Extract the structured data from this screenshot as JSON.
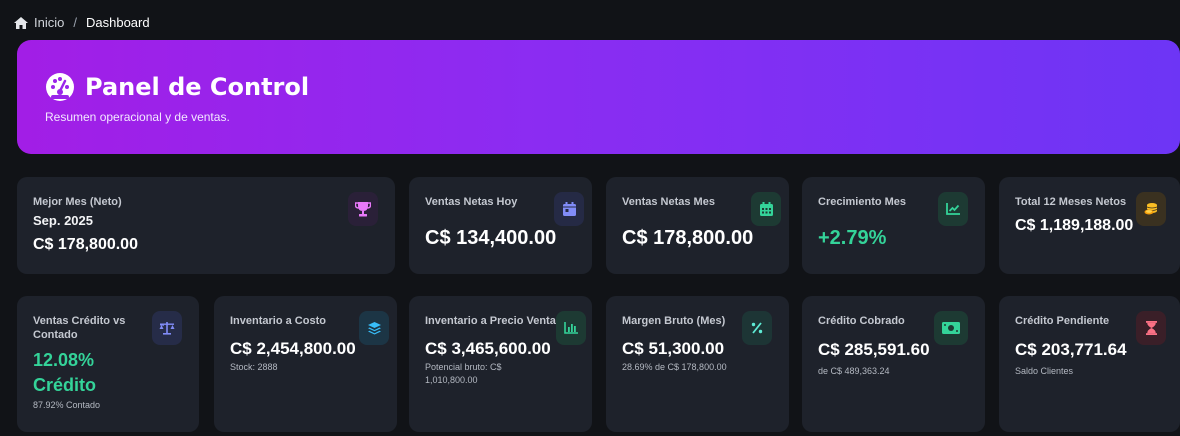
{
  "breadcrumb": {
    "home": "Inicio",
    "separator": "/",
    "current": "Dashboard"
  },
  "hero": {
    "title": "Panel de Control",
    "subtitle": "Resumen operacional y de ventas."
  },
  "colors": {
    "hero_start": "#a21ee6",
    "hero_end": "#6d35f5",
    "card_bg": "#1e222b",
    "positive": "#34d399"
  },
  "row1": {
    "best_month": {
      "label": "Mejor Mes (Neto)",
      "period": "Sep. 2025",
      "value": "C$ 178,800.00",
      "icon": "trophy-icon"
    },
    "sales_today": {
      "label": "Ventas Netas Hoy",
      "value": "C$ 134,400.00",
      "icon": "calendar-day-icon"
    },
    "sales_month": {
      "label": "Ventas Netas Mes",
      "value": "C$ 178,800.00",
      "icon": "calendar-icon"
    },
    "growth": {
      "label": "Crecimiento Mes",
      "value": "+2.79%",
      "icon": "chart-line-icon"
    },
    "total12": {
      "label": "Total 12 Meses Netos",
      "value": "C$ 1,189,188.00",
      "icon": "coins-icon"
    }
  },
  "row2": {
    "credit_vs_cash": {
      "label": "Ventas Crédito vs Contado",
      "percent": "12.08%",
      "kind": "Crédito",
      "sub": "87.92% Contado",
      "icon": "scale-icon"
    },
    "inv_cost": {
      "label": "Inventario a Costo",
      "value": "C$ 2,454,800.00",
      "sub": "Stock: 2888",
      "icon": "layers-icon"
    },
    "inv_price": {
      "label": "Inventario a Precio Venta",
      "value": "C$ 3,465,600.00",
      "sub": "Potencial bruto: C$ 1,010,800.00",
      "icon": "bar-chart-icon"
    },
    "margin": {
      "label": "Margen Bruto (Mes)",
      "value": "C$ 51,300.00",
      "sub": "28.69% de C$ 178,800.00",
      "icon": "percent-icon"
    },
    "credit_collected": {
      "label": "Crédito Cobrado",
      "value": "C$ 285,591.60",
      "sub": "de C$ 489,363.24",
      "icon": "money-bill-icon"
    },
    "credit_pending": {
      "label": "Crédito Pendiente",
      "value": "C$ 203,771.64",
      "sub": "Saldo Clientes",
      "icon": "hourglass-icon"
    }
  }
}
